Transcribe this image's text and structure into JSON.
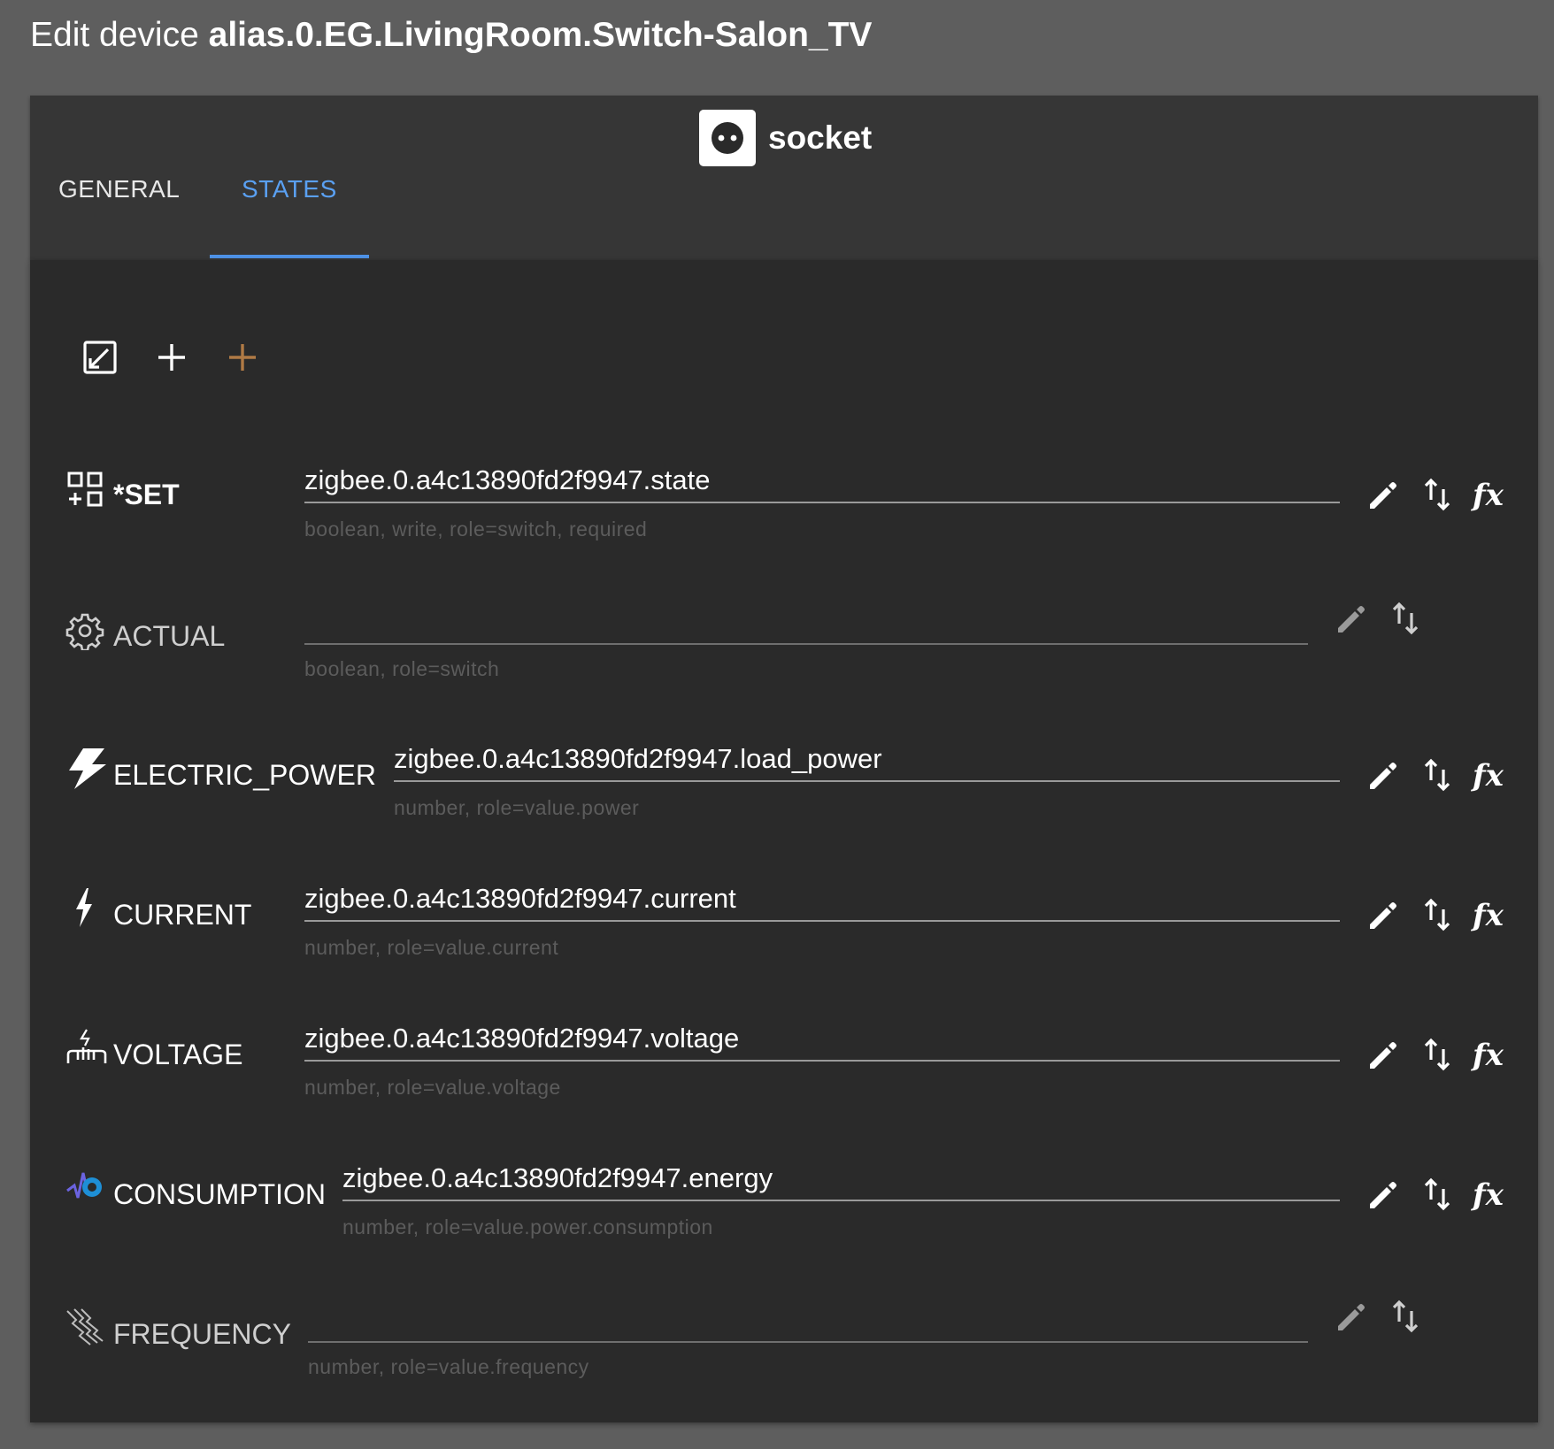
{
  "dialog": {
    "title_prefix": "Edit device",
    "title_id": "alias.0.EG.LivingRoom.Switch-Salon_TV"
  },
  "device": {
    "type": "socket"
  },
  "tabs": [
    {
      "label": "GENERAL",
      "active": false
    },
    {
      "label": "STATES",
      "active": true
    }
  ],
  "toolbar": {
    "icons": [
      "expand-icon",
      "add-icon",
      "add-optional-icon"
    ]
  },
  "states": [
    {
      "name": "*SET",
      "icon": "widgets-icon",
      "value": "zigbee.0.a4c13890fd2f9947.state",
      "helper": "boolean, write, role=switch, required",
      "has_formula": true
    },
    {
      "name": "ACTUAL",
      "icon": "gear-icon",
      "value": "",
      "helper": "boolean, role=switch",
      "has_formula": false
    },
    {
      "name": "ELECTRIC_POWER",
      "icon": "lightning-icon",
      "value": "zigbee.0.a4c13890fd2f9947.load_power",
      "helper": "number, role=value.power",
      "has_formula": true
    },
    {
      "name": "CURRENT",
      "icon": "bolt-icon",
      "value": "zigbee.0.a4c13890fd2f9947.current",
      "helper": "number, role=value.current",
      "has_formula": true
    },
    {
      "name": "VOLTAGE",
      "icon": "voltage-icon",
      "value": "zigbee.0.a4c13890fd2f9947.voltage",
      "helper": "number, role=value.voltage",
      "has_formula": true
    },
    {
      "name": "CONSUMPTION",
      "icon": "consumption-icon",
      "value": "zigbee.0.a4c13890fd2f9947.energy",
      "helper": "number, role=value.power.consumption",
      "has_formula": true
    },
    {
      "name": "FREQUENCY",
      "icon": "frequency-icon",
      "value": "",
      "helper": "number, role=value.frequency",
      "has_formula": false
    }
  ],
  "colors": {
    "accent": "#5aa0f2",
    "add_optional": "#b07a45",
    "panel": "#2a2a2a",
    "header": "#363636",
    "backdrop": "#5e5e5e"
  }
}
